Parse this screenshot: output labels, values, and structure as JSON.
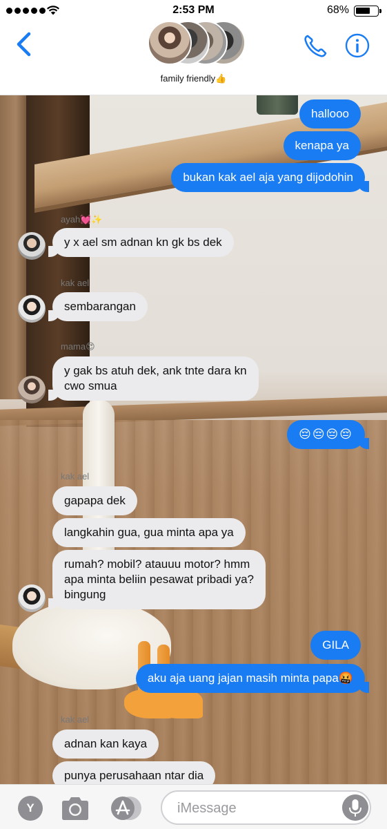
{
  "status_bar": {
    "time": "2:53 PM",
    "battery": "68%",
    "battery_level": 0.68
  },
  "header": {
    "group_name": "family friendly👍"
  },
  "messages": [
    {
      "dir": "out",
      "text": "hallooo"
    },
    {
      "dir": "out",
      "text": "kenapa ya"
    },
    {
      "dir": "out",
      "text": "bukan kak ael aja yang dijodohin"
    },
    {
      "sender": "ayah💓✨",
      "dir": "in",
      "text": "y x ael sm adnan kn gk bs dek"
    },
    {
      "sender": "kak ael",
      "dir": "in",
      "text": "sembarangan"
    },
    {
      "sender": "mama😍",
      "dir": "in",
      "text": "y gak bs atuh dek, ank tnte dara kn\ncwo smua"
    },
    {
      "dir": "out",
      "text": "😔😔😔😔"
    },
    {
      "sender": "kak ael",
      "dir": "in",
      "text": "gapapa dek"
    },
    {
      "dir": "in",
      "text": "langkahin gua, gua minta apa ya"
    },
    {
      "dir": "in",
      "text": "rumah? mobil? atauuu motor? hmm\napa minta beliin pesawat pribadi ya?\nbingung"
    },
    {
      "dir": "out",
      "text": "GILA"
    },
    {
      "dir": "out",
      "text": "aku aja uang jajan masih minta papa🤬"
    },
    {
      "sender": "kak ael",
      "dir": "in",
      "text": "adnan kan kaya"
    },
    {
      "dir": "in",
      "text": "punya perusahaan ntar dia"
    }
  ],
  "toolbar": {
    "apps_button": "Y",
    "input_placeholder": "iMessage"
  },
  "icons": {
    "back": "chevron-left-icon",
    "call": "phone-icon",
    "info": "info-icon",
    "camera": "camera-icon",
    "app_store": "app-store-icon",
    "mic": "microphone-icon"
  },
  "colors": {
    "accent": "#1a7cf2",
    "incoming_bubble": "#ebebed"
  }
}
